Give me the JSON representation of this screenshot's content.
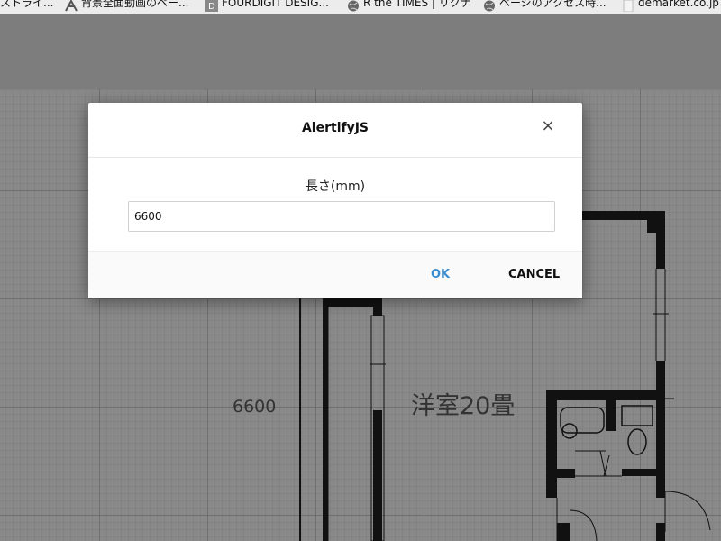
{
  "bookmarks": [
    {
      "label": "ストライ...",
      "icon": "none"
    },
    {
      "label": "背景全面動画のペー...",
      "icon": "x-logo-icon"
    },
    {
      "label": "FOURDIGIT DESIG...",
      "icon": "d-logo-icon"
    },
    {
      "label": "R the TIMES | リクナ",
      "icon": "globe-icon"
    },
    {
      "label": "ページのアクセス時...",
      "icon": "globe-icon"
    },
    {
      "label": "demarket.co.jp",
      "icon": "page-icon"
    }
  ],
  "floorplan": {
    "dimension_label": "6600",
    "room_label": "洋室20畳"
  },
  "dialog": {
    "title": "AlertifyJS",
    "close_label": "×",
    "field_label": "長さ(mm)",
    "input_value": "6600",
    "ok_label": "OK",
    "cancel_label": "CANCEL"
  },
  "colors": {
    "overlay": "#7d7d7d",
    "ok_accent": "#3a8ed1",
    "wall": "#111111"
  }
}
